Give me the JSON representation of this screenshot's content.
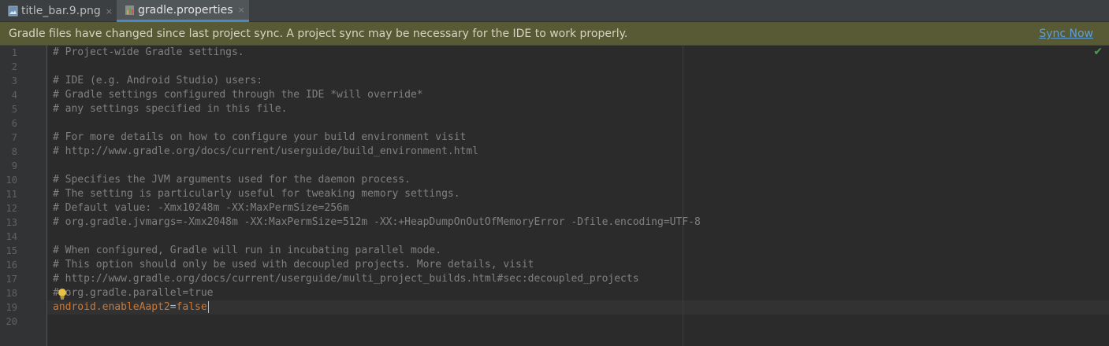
{
  "tabs": [
    {
      "label": "title_bar.9.png",
      "close": "×",
      "icon": "image-file-icon"
    },
    {
      "label": "gradle.properties",
      "close": "×",
      "icon": "gradle-properties-icon",
      "active": true
    }
  ],
  "banner": {
    "message": "Gradle files have changed since last project sync. A project sync may be necessary for the IDE to work properly.",
    "action": "Sync Now"
  },
  "editor": {
    "line_numbers": [
      "1",
      "2",
      "3",
      "4",
      "5",
      "6",
      "7",
      "8",
      "9",
      "10",
      "11",
      "12",
      "13",
      "14",
      "15",
      "16",
      "17",
      "18",
      "19",
      "20"
    ],
    "lines": [
      "# Project-wide Gradle settings.",
      "",
      "# IDE (e.g. Android Studio) users:",
      "# Gradle settings configured through the IDE *will override*",
      "# any settings specified in this file.",
      "",
      "# For more details on how to configure your build environment visit",
      "# http://www.gradle.org/docs/current/userguide/build_environment.html",
      "",
      "# Specifies the JVM arguments used for the daemon process.",
      "# The setting is particularly useful for tweaking memory settings.",
      "# Default value: -Xmx10248m -XX:MaxPermSize=256m",
      "# org.gradle.jvmargs=-Xmx2048m -XX:MaxPermSize=512m -XX:+HeapDumpOnOutOfMemoryError -Dfile.encoding=UTF-8",
      "",
      "# When configured, Gradle will run in incubating parallel mode.",
      "# This option should only be used with decoupled projects. More details, visit",
      "# http://www.gradle.org/docs/current/userguide/multi_project_builds.html#sec:decoupled_projects",
      "# org.gradle.parallel=true"
    ],
    "last_line": {
      "key": "android.enableAapt2",
      "sep": "=",
      "value": "false"
    }
  },
  "colors": {
    "banner_bg": "#585a35",
    "link": "#5f9fd6",
    "comment": "#808080",
    "key": "#cc7832",
    "check": "#499c54"
  }
}
